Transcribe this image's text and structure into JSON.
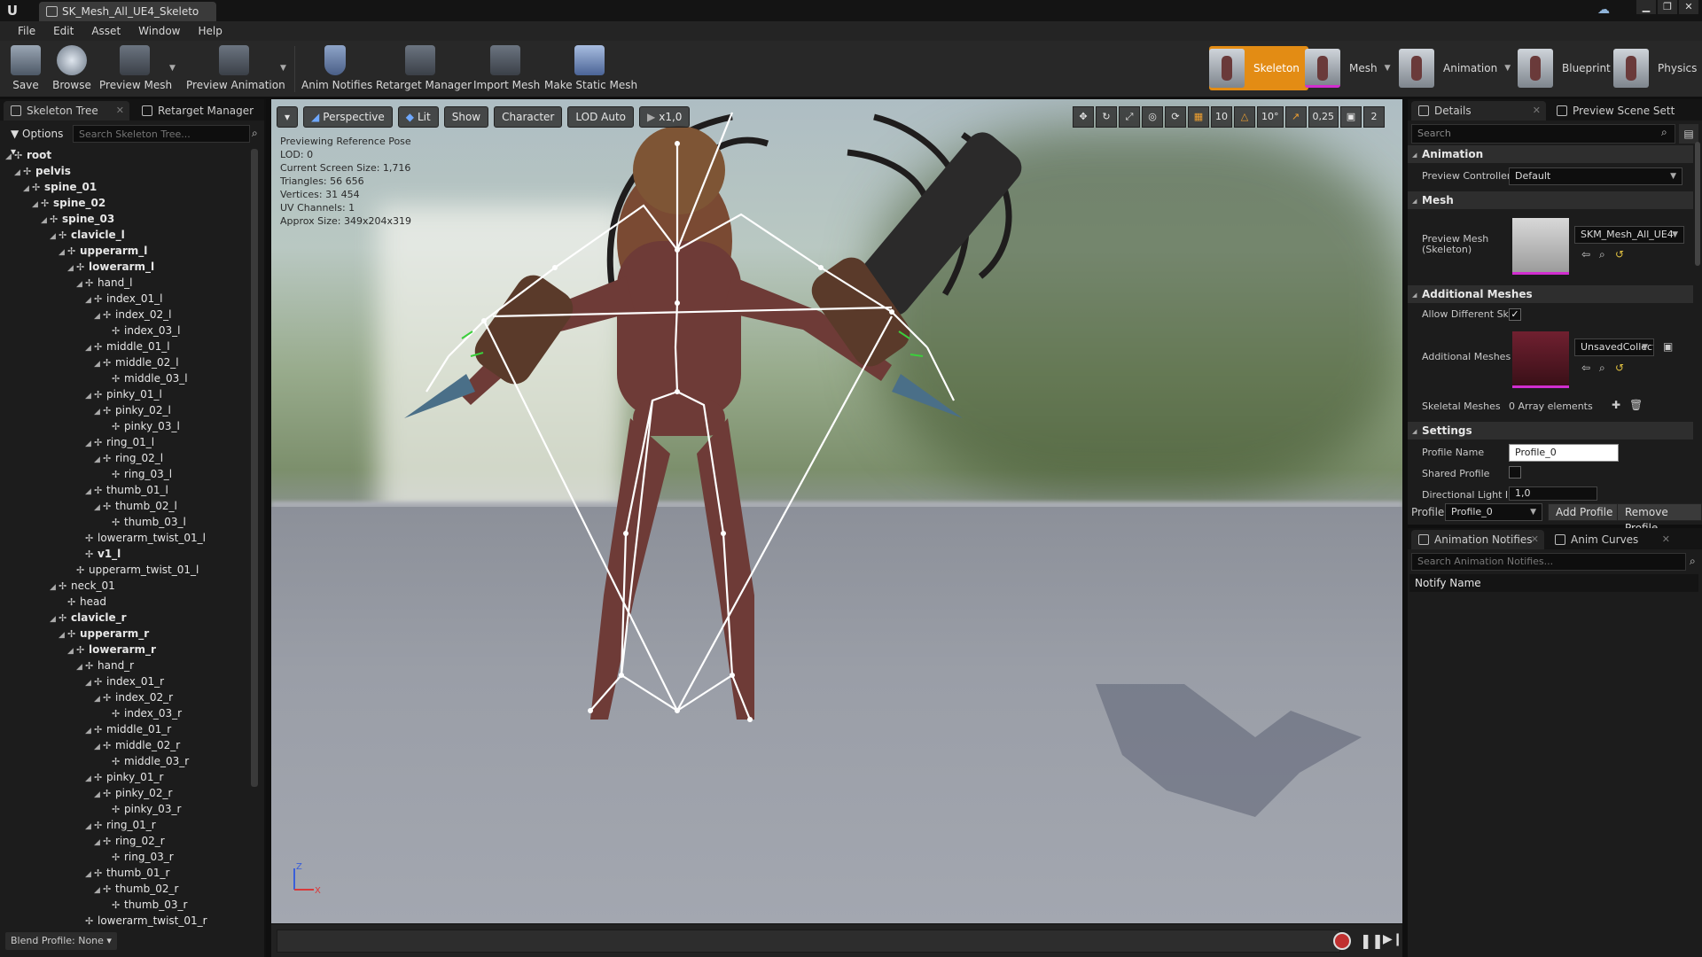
{
  "window": {
    "tab_title": "SK_Mesh_All_UE4_Skeleto",
    "logo": "U",
    "buttons": [
      "▁",
      "❐",
      "✕"
    ]
  },
  "menu": [
    "File",
    "Edit",
    "Asset",
    "Window",
    "Help"
  ],
  "toolbar": {
    "save": "Save",
    "browse": "Browse",
    "preview_mesh": "Preview Mesh",
    "preview_animation": "Preview Animation",
    "anim_notifies": "Anim Notifies",
    "retarget_manager": "Retarget Manager",
    "import_mesh": "Import Mesh",
    "make_static_mesh": "Make Static Mesh"
  },
  "modes": {
    "skeleton": "Skeleton",
    "mesh": "Mesh",
    "animation": "Animation",
    "blueprint": "Blueprint",
    "physics": "Physics"
  },
  "left_panel": {
    "tab_skeleton_tree": "Skeleton Tree",
    "tab_retarget_manager": "Retarget Manager",
    "options": "Options",
    "search_placeholder": "Search Skeleton Tree...",
    "blend_profile": "Blend Profile: None",
    "bones": [
      {
        "name": "root",
        "depth": 0,
        "bold": true
      },
      {
        "name": "pelvis",
        "depth": 1,
        "bold": true
      },
      {
        "name": "spine_01",
        "depth": 2,
        "bold": true
      },
      {
        "name": "spine_02",
        "depth": 3,
        "bold": true
      },
      {
        "name": "spine_03",
        "depth": 4,
        "bold": true
      },
      {
        "name": "clavicle_l",
        "depth": 5,
        "bold": true
      },
      {
        "name": "upperarm_l",
        "depth": 6,
        "bold": true
      },
      {
        "name": "lowerarm_l",
        "depth": 7,
        "bold": true
      },
      {
        "name": "hand_l",
        "depth": 8,
        "bold": false
      },
      {
        "name": "index_01_l",
        "depth": 9,
        "bold": false
      },
      {
        "name": "index_02_l",
        "depth": 10,
        "bold": false
      },
      {
        "name": "index_03_l",
        "depth": 11,
        "bold": false
      },
      {
        "name": "middle_01_l",
        "depth": 9,
        "bold": false
      },
      {
        "name": "middle_02_l",
        "depth": 10,
        "bold": false
      },
      {
        "name": "middle_03_l",
        "depth": 11,
        "bold": false
      },
      {
        "name": "pinky_01_l",
        "depth": 9,
        "bold": false
      },
      {
        "name": "pinky_02_l",
        "depth": 10,
        "bold": false
      },
      {
        "name": "pinky_03_l",
        "depth": 11,
        "bold": false
      },
      {
        "name": "ring_01_l",
        "depth": 9,
        "bold": false
      },
      {
        "name": "ring_02_l",
        "depth": 10,
        "bold": false
      },
      {
        "name": "ring_03_l",
        "depth": 11,
        "bold": false
      },
      {
        "name": "thumb_01_l",
        "depth": 9,
        "bold": false
      },
      {
        "name": "thumb_02_l",
        "depth": 10,
        "bold": false
      },
      {
        "name": "thumb_03_l",
        "depth": 11,
        "bold": false
      },
      {
        "name": "lowerarm_twist_01_l",
        "depth": 8,
        "bold": false
      },
      {
        "name": "v1_l",
        "depth": 8,
        "bold": true
      },
      {
        "name": "upperarm_twist_01_l",
        "depth": 7,
        "bold": false
      },
      {
        "name": "neck_01",
        "depth": 5,
        "bold": false
      },
      {
        "name": "head",
        "depth": 6,
        "bold": false
      },
      {
        "name": "clavicle_r",
        "depth": 5,
        "bold": true
      },
      {
        "name": "upperarm_r",
        "depth": 6,
        "bold": true
      },
      {
        "name": "lowerarm_r",
        "depth": 7,
        "bold": true
      },
      {
        "name": "hand_r",
        "depth": 8,
        "bold": false
      },
      {
        "name": "index_01_r",
        "depth": 9,
        "bold": false
      },
      {
        "name": "index_02_r",
        "depth": 10,
        "bold": false
      },
      {
        "name": "index_03_r",
        "depth": 11,
        "bold": false
      },
      {
        "name": "middle_01_r",
        "depth": 9,
        "bold": false
      },
      {
        "name": "middle_02_r",
        "depth": 10,
        "bold": false
      },
      {
        "name": "middle_03_r",
        "depth": 11,
        "bold": false
      },
      {
        "name": "pinky_01_r",
        "depth": 9,
        "bold": false
      },
      {
        "name": "pinky_02_r",
        "depth": 10,
        "bold": false
      },
      {
        "name": "pinky_03_r",
        "depth": 11,
        "bold": false
      },
      {
        "name": "ring_01_r",
        "depth": 9,
        "bold": false
      },
      {
        "name": "ring_02_r",
        "depth": 10,
        "bold": false
      },
      {
        "name": "ring_03_r",
        "depth": 11,
        "bold": false
      },
      {
        "name": "thumb_01_r",
        "depth": 9,
        "bold": false
      },
      {
        "name": "thumb_02_r",
        "depth": 10,
        "bold": false
      },
      {
        "name": "thumb_03_r",
        "depth": 11,
        "bold": false
      },
      {
        "name": "lowerarm_twist_01_r",
        "depth": 8,
        "bold": false
      }
    ]
  },
  "viewport": {
    "dropdown": "▾",
    "perspective": "Perspective",
    "lit": "Lit",
    "show": "Show",
    "character": "Character",
    "lod": "LOD Auto",
    "speed": "x1,0",
    "grid_snap": "10",
    "rot_snap": "10°",
    "scale_snap": "0,25",
    "camera_speed": "2",
    "info": [
      "Previewing Reference Pose",
      "LOD: 0",
      "Current Screen Size: 1,716",
      "Triangles: 56 656",
      "Vertices: 31 454",
      "UV Channels: 1",
      "Approx Size: 349x204x319"
    ],
    "axis_z": "Z",
    "axis_x": "X"
  },
  "details": {
    "tab_details": "Details",
    "tab_preview_scene": "Preview Scene Sett",
    "search_placeholder": "Search",
    "cat_animation": "Animation",
    "preview_controller_label": "Preview Controller",
    "preview_controller_value": "Default",
    "cat_mesh": "Mesh",
    "preview_mesh_label": "Preview Mesh (Skeleton)",
    "preview_mesh_value": "SKM_Mesh_All_UE4",
    "cat_additional": "Additional Meshes",
    "allow_different_label": "Allow Different Sk",
    "additional_meshes_label": "Additional Meshes",
    "additional_meshes_value": "UnsavedCollect",
    "skeletal_meshes_label": "Skeletal Meshes",
    "skeletal_meshes_value": "0 Array elements",
    "cat_settings": "Settings",
    "profile_name_label": "Profile Name",
    "profile_name_value": "Profile_0",
    "shared_profile_label": "Shared Profile",
    "directional_light_label": "Directional Light Ir",
    "directional_light_value": "1,0",
    "profile_label": "Profile",
    "profile_value": "Profile_0",
    "add_profile": "Add Profile",
    "remove_profile": "Remove Profile"
  },
  "notifies": {
    "tab_notifies": "Animation Notifies",
    "tab_curves": "Anim Curves",
    "search_placeholder": "Search Animation Notifies...",
    "header": "Notify Name"
  }
}
